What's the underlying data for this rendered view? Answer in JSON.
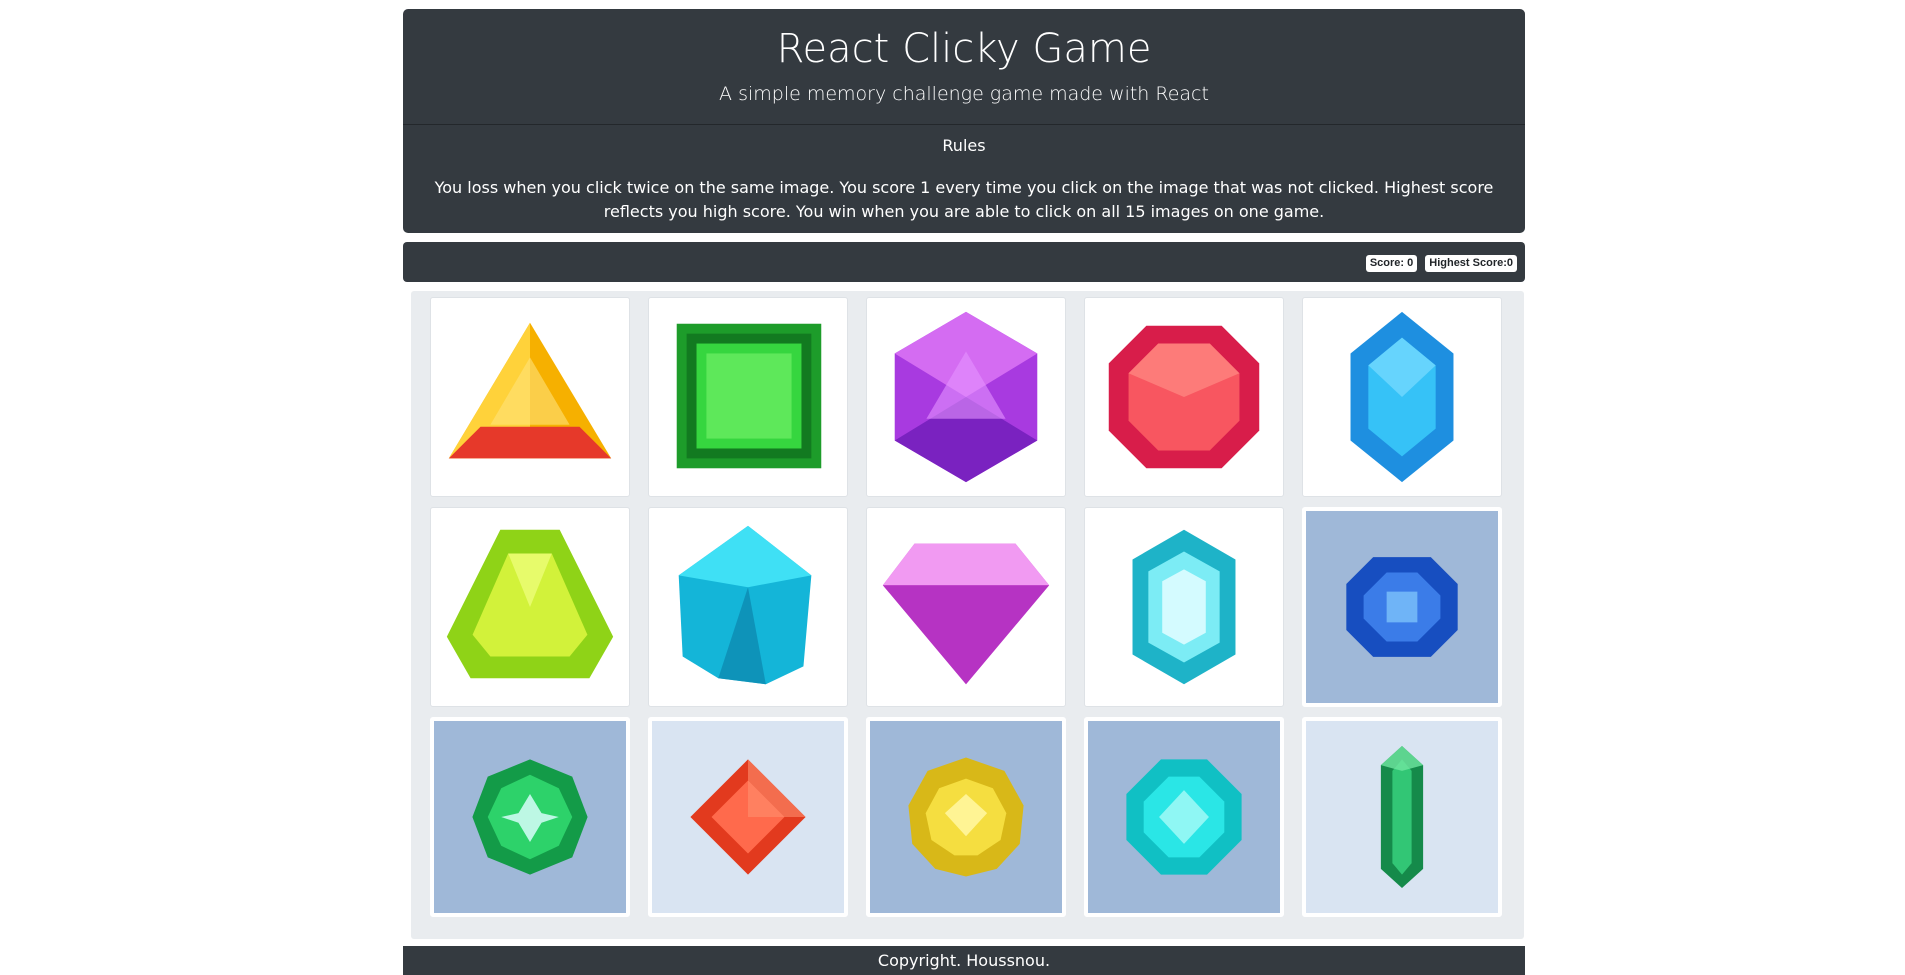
{
  "header": {
    "title": "React Clicky Game",
    "subtitle": "A simple memory challenge game made with React",
    "rules_title": "Rules",
    "rules_text": "You loss when you click twice on the same image. You score 1 every time you click on the image that was not clicked. Highest score reflects you high score. You win when you are able to click on all 15 images on one game."
  },
  "scoreboard": {
    "score_label": "Score: 0",
    "highest_label": "Highest Score:0",
    "score": 0,
    "highest_score": 0
  },
  "footer": {
    "text": "Copyright. Houssnou."
  },
  "tiles": [
    {
      "name": "yellow-triangle-gem-icon",
      "color": "#f5b400"
    },
    {
      "name": "green-square-gem-icon",
      "color": "#2fd13a"
    },
    {
      "name": "purple-hexagon-gem-icon",
      "color": "#b54ae8"
    },
    {
      "name": "red-octagon-gem-icon",
      "color": "#f0414f"
    },
    {
      "name": "blue-hexagon-gem-icon",
      "color": "#22a6ee"
    },
    {
      "name": "lime-triangle-gem-icon",
      "color": "#b8e81e"
    },
    {
      "name": "cyan-crystal-gem-icon",
      "color": "#1ec8e8"
    },
    {
      "name": "pink-diamond-gem-icon",
      "color": "#e86be0"
    },
    {
      "name": "teal-hexagon-gem-icon",
      "color": "#3fd4e0"
    },
    {
      "name": "blue-square-gem-icon",
      "color": "#1e64d8"
    },
    {
      "name": "green-round-gem-icon",
      "color": "#1fb85a"
    },
    {
      "name": "red-diamond-gem-icon",
      "color": "#f04a2a"
    },
    {
      "name": "yellow-round-gem-icon",
      "color": "#f0d020"
    },
    {
      "name": "cyan-octagon-gem-icon",
      "color": "#18d8d8"
    },
    {
      "name": "green-long-crystal-icon",
      "color": "#1fa85a"
    }
  ]
}
